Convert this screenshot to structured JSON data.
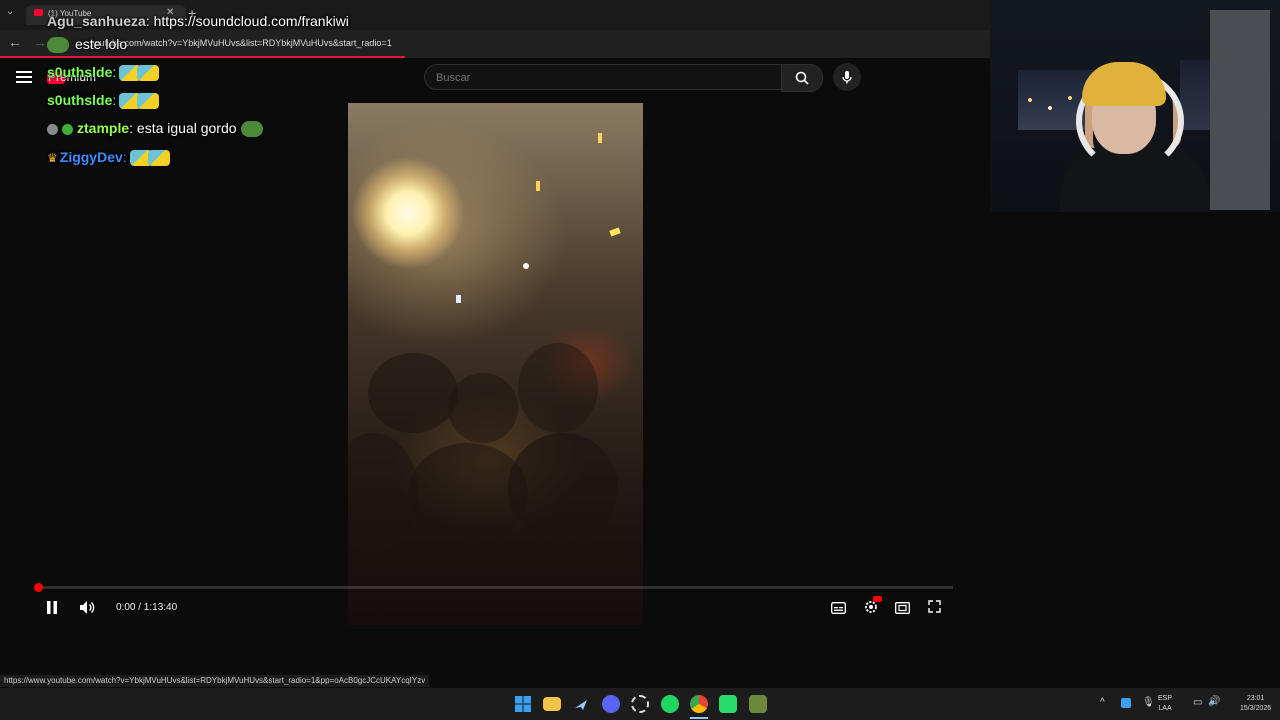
{
  "browser": {
    "tab_title": "(1) YouTube",
    "tab_close": "✕",
    "new_tab": "+",
    "url": "youtube.com/watch?v=YbkjMVuHUvs&list=RDYbkjMVuHUvs&start_radio=1"
  },
  "youtube": {
    "premium_label": "Premium",
    "search_placeholder": "Buscar"
  },
  "chat": [
    {
      "user": "Agu_sanhueza",
      "sep": ": ",
      "message": "https://soundcloud.com/frankiwi",
      "color": "#c9c9c9"
    },
    {
      "user": "",
      "sep": "",
      "message": "este lolo",
      "color": "#ffffff"
    },
    {
      "user": "s0uthslde",
      "sep": ":",
      "message": "",
      "color": "#7dff5a"
    },
    {
      "user": "s0uthslde",
      "sep": ":",
      "message": "",
      "color": "#7dff5a"
    },
    {
      "user": "ztample",
      "sep": ": ",
      "message": "esta igual gordo",
      "color": "#9cff4e"
    },
    {
      "user": "ZiggyDev",
      "sep": ":",
      "message": "",
      "color": "#3c8dff"
    }
  ],
  "player": {
    "time": "0:00 / 1:13:40",
    "progress": 0.0
  },
  "status_url": "https://www.youtube.com/watch?v=YbkjMVuHUvs&list=RDYbkjMVuHUvs&start_radio=1&pp=oAcB0gcJCcUKAYcqIYzv",
  "taskbar": {
    "lang_top": "ESP",
    "lang_bottom": "LAA",
    "time": "23:01",
    "date": "15/3/2026"
  },
  "colors": {
    "accent": "#ff0033",
    "progress": "#ff0000"
  }
}
